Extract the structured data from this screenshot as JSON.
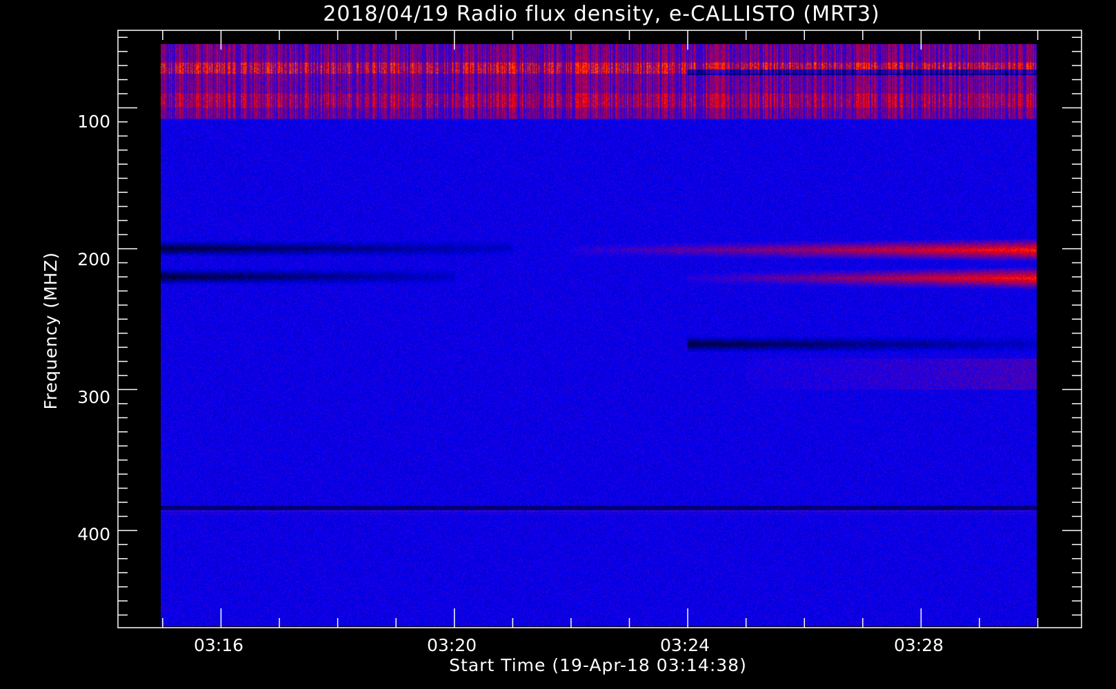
{
  "chart_data": {
    "type": "heatmap",
    "title": "2018/04/19  Radio flux density, e-CALLISTO (MRT3)",
    "xlabel": "Start Time (19-Apr-18 03:14:38)",
    "ylabel": "Frequency (MHZ)",
    "x_unit": "time (HH:MM UT)",
    "xlim": [
      "03:14:14",
      "03:30:45"
    ],
    "data_x_range": [
      "03:14:58",
      "03:29:59"
    ],
    "x_major_ticks": [
      "03:16",
      "03:20",
      "03:24",
      "03:28"
    ],
    "ylim": [
      45,
      469
    ],
    "data_y_range": [
      55,
      468
    ],
    "y_reversed": true,
    "y_major_ticks": [
      100,
      200,
      300,
      400
    ],
    "colormap": [
      "#000000",
      "#0000ff",
      "#ff0000",
      "#ffff00"
    ],
    "features": [
      {
        "kind": "rfi-band",
        "freq_range": [
          55,
          108
        ],
        "time_range": [
          "03:14:58",
          "03:29:59"
        ],
        "level": "high"
      },
      {
        "kind": "emission-lane",
        "freq": 201,
        "time_range": [
          "03:22:00",
          "03:29:59"
        ],
        "level": "increasing"
      },
      {
        "kind": "emission-lane",
        "freq": 221,
        "time_range": [
          "03:24:00",
          "03:29:59"
        ],
        "level": "increasing"
      },
      {
        "kind": "absorption-lane",
        "freq": 200,
        "time_range": [
          "03:14:58",
          "03:21:00"
        ]
      },
      {
        "kind": "absorption-lane",
        "freq": 220,
        "time_range": [
          "03:14:58",
          "03:20:00"
        ]
      },
      {
        "kind": "absorption-lane",
        "freq": 268,
        "time_range": [
          "03:24:00",
          "03:29:59"
        ]
      },
      {
        "kind": "weak-emission",
        "freq_range": [
          278,
          300
        ],
        "time_range": [
          "03:25:00",
          "03:29:59"
        ]
      },
      {
        "kind": "narrow-line",
        "freq": 384,
        "time_range": [
          "03:14:58",
          "03:29:59"
        ]
      }
    ]
  }
}
